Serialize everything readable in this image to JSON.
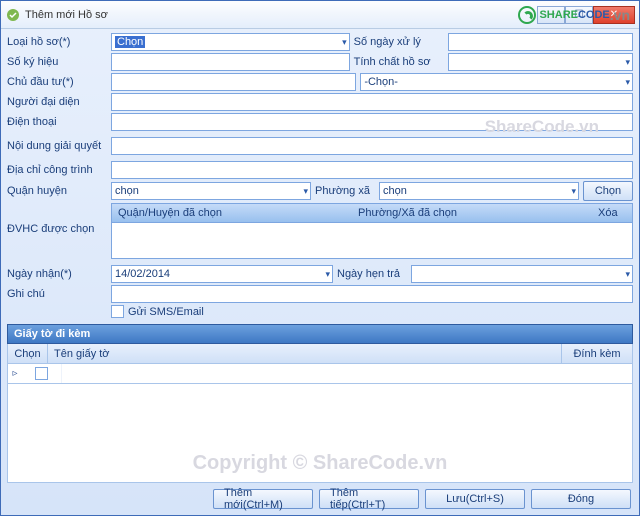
{
  "title": "Thêm mới Hồ sơ",
  "labels": {
    "loai_hs": "Loại hồ sơ(*)",
    "so_ngay": "Số ngày xử lý",
    "so_ky_hieu": "Số ký hiệu",
    "tinh_chat": "Tính chất hồ sơ",
    "chu_dau_tu": "Chủ đầu tư(*)",
    "nguoi_dd": "Người đại diện",
    "dien_thoai": "Điện thoại",
    "noi_dung": "Nội dung giải quyết",
    "dia_chi": "Địa chỉ công trình",
    "quan_huyen": "Quận huyện",
    "phuong_xa": "Phường xã",
    "dvhc": "ĐVHC được chọn",
    "ngay_nhan": "Ngày nhận(*)",
    "ngay_hen": "Ngày hẹn trả",
    "ghi_chu": "Ghi chú",
    "gui_sms": "Gửi SMS/Email"
  },
  "values": {
    "loai_hs": "Chọn",
    "chu_dau_tu_sel": "-Chọn-",
    "quan_huyen": "chọn",
    "phuong_xa": "chọn",
    "ngay_nhan": "14/02/2014"
  },
  "buttons": {
    "chon": "Chọn",
    "them_moi": "Thêm mới(Ctrl+M)",
    "them_tiep": "Thêm tiếp(Ctrl+T)",
    "luu": "Lưu(Ctrl+S)",
    "dong": "Đóng"
  },
  "grid1": {
    "col1": "Quận/Huyện đã chọn",
    "col2": "Phường/Xã đã chọn",
    "col3": "Xóa"
  },
  "panel": "Giấy tờ đi kèm",
  "grid2": {
    "col1": "Chọn",
    "col2": "Tên giấy tờ",
    "col3": "Đính kèm"
  },
  "watermark1": "ShareCode.vn",
  "watermark2": "Copyright © ShareCode.vn",
  "brand": {
    "p1": "SHARE",
    "p2": "CODE",
    "p3": ".vn"
  }
}
